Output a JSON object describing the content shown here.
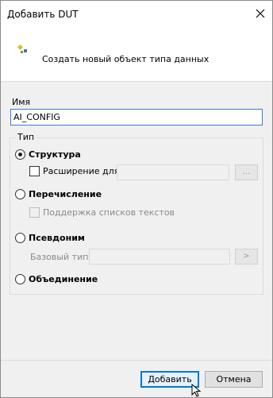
{
  "window": {
    "title": "Добавить DUT"
  },
  "header": {
    "icon": "dut-type-icon",
    "text": "Создать новый объект типа данных"
  },
  "name_field": {
    "label": "Имя",
    "value": "AI_CONFIG"
  },
  "type_group": {
    "title": "Тип",
    "options": [
      {
        "label": "Структура",
        "selected": true
      },
      {
        "label": "Перечисление",
        "selected": false
      },
      {
        "label": "Псевдоним",
        "selected": false
      },
      {
        "label": "Объединение",
        "selected": false
      }
    ],
    "extension_label": "Расширение для",
    "extension_browse": "...",
    "text_list_support_label": "Поддержка списков текстов",
    "base_type_label": "Базовый тип",
    "base_type_browse": ">"
  },
  "buttons": {
    "add": "Добавить",
    "cancel": "Отмена"
  },
  "colors": {
    "focus_border": "#0078d7",
    "input_border": "#3b7bd0"
  }
}
